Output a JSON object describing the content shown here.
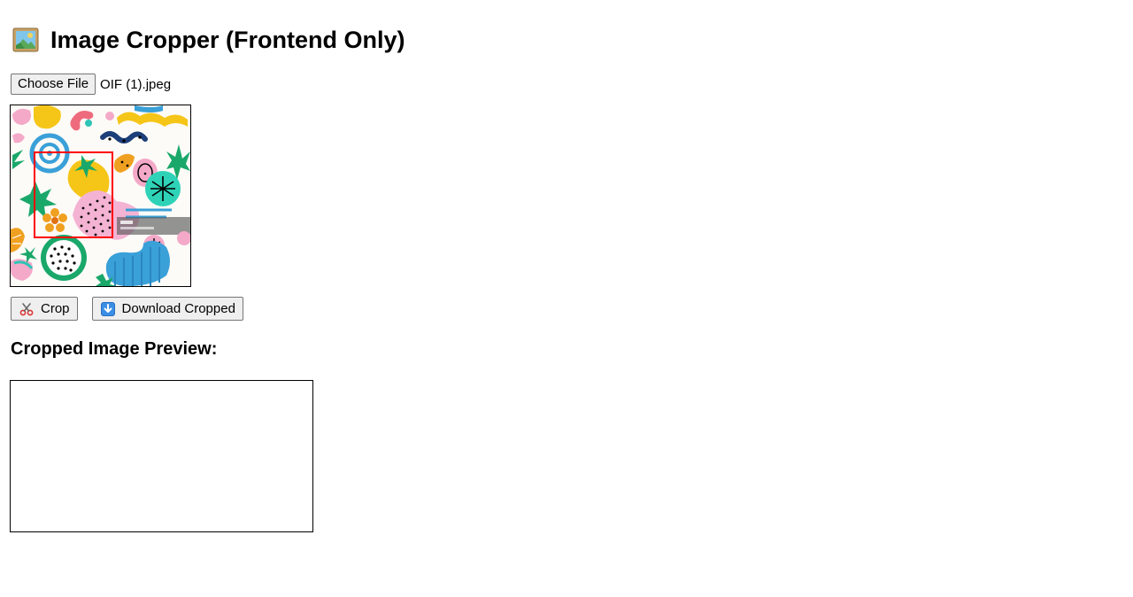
{
  "header": {
    "title": "Image Cropper (Frontend Only)",
    "icon": "framed-picture-icon"
  },
  "file_input": {
    "button_label": "Choose File",
    "file_name": "OIF (1).jpeg"
  },
  "canvas": {
    "image_description_icon": "abstract-pattern-image",
    "selection_color": "#ff0000"
  },
  "actions": {
    "crop_label": "Crop",
    "crop_icon": "scissors-icon",
    "download_label": "Download Cropped",
    "download_icon": "down-arrow-icon"
  },
  "preview": {
    "heading": "Cropped Image Preview:"
  }
}
